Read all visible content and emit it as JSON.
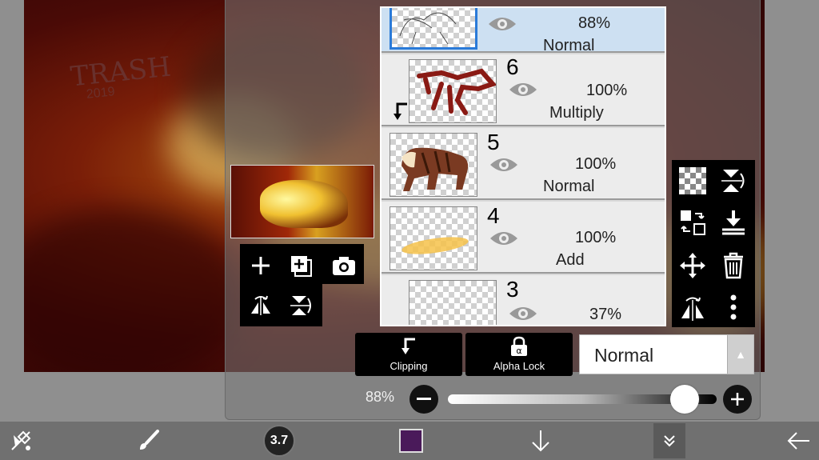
{
  "canvas": {
    "signature_text": "TRASH",
    "signature_year": "2019"
  },
  "layers": [
    {
      "number": "",
      "opacity": "88%",
      "blend": "Normal",
      "selected": true,
      "clipped": false
    },
    {
      "number": "6",
      "opacity": "100%",
      "blend": "Multiply",
      "selected": false,
      "clipped": true
    },
    {
      "number": "5",
      "opacity": "100%",
      "blend": "Normal",
      "selected": false,
      "clipped": false
    },
    {
      "number": "4",
      "opacity": "100%",
      "blend": "Add",
      "selected": false,
      "clipped": false
    },
    {
      "number": "3",
      "opacity": "37%",
      "blend": "",
      "selected": false,
      "clipped": true
    }
  ],
  "layer_tools_left": [
    "add-layer-icon",
    "add-copy-layer-icon",
    "camera-icon",
    "flip-horizontal-icon",
    "flip-vertical-icon"
  ],
  "layer_tools_right": [
    "transparency-icon",
    "flip-vertical-rotate-icon",
    "swap-layer-icon",
    "merge-down-icon",
    "move-icon",
    "trash-icon",
    "rotate-flip-icon",
    "more-icon"
  ],
  "controls": {
    "clipping_label": "Clipping",
    "alpha_lock_label": "Alpha Lock",
    "blend_mode": "Normal",
    "opacity_label": "88%",
    "opacity_value": 0.88
  },
  "bottom_bar": {
    "brush_size": "3.7",
    "color": "#4a1a5a",
    "icons": [
      "transform-icon",
      "brush-icon",
      "brush-size",
      "color-swatch",
      "download-arrow-icon",
      "menu-chevron-icon",
      "back-arrow-icon"
    ]
  },
  "colors": {
    "panel_bg": "#787878",
    "selected_layer": "#cde0f2",
    "bottom_bar": "#707070"
  }
}
